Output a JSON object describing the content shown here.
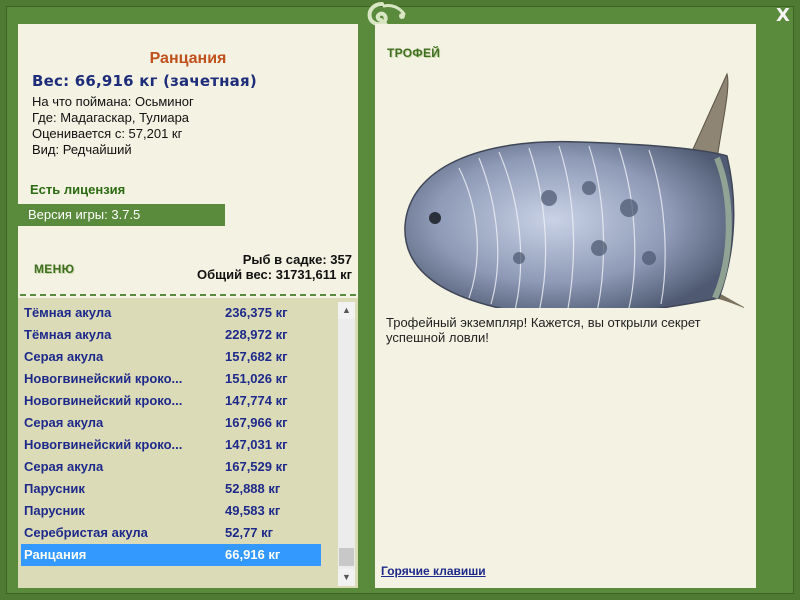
{
  "window": {
    "close_label": "X"
  },
  "left": {
    "fish_name": "Ранцания",
    "weight_line": "Вес: 66,916 кг (зачетная)",
    "info": [
      "На что поймана: Осьминог",
      "Где: Мадагаскар, Тулиара",
      "Оценивается с: 57,201 кг",
      "Вид: Редчайший"
    ],
    "license": "Есть лицензия",
    "version": "Версия игры: 3.7.5",
    "menu_label": "МЕНЮ",
    "fish_in_cage": "Рыб в садке: 357",
    "total_weight": "Общий вес: 31731,611 кг"
  },
  "catch_list": [
    {
      "name": "Тёмная акула",
      "weight": "236,375 кг"
    },
    {
      "name": "Тёмная акула",
      "weight": "228,972 кг"
    },
    {
      "name": "Серая акула",
      "weight": "157,682 кг"
    },
    {
      "name": "Новогвинейский кроко...",
      "weight": "151,026 кг"
    },
    {
      "name": "Новогвинейский кроко...",
      "weight": "147,774 кг"
    },
    {
      "name": "Серая акула",
      "weight": "167,966 кг"
    },
    {
      "name": "Новогвинейский кроко...",
      "weight": "147,031 кг"
    },
    {
      "name": "Серая акула",
      "weight": "167,529 кг"
    },
    {
      "name": "Парусник",
      "weight": "52,888 кг"
    },
    {
      "name": "Парусник",
      "weight": "49,583 кг"
    },
    {
      "name": "Серебристая акула",
      "weight": "52,77 кг"
    },
    {
      "name": "Ранцания",
      "weight": "66,916 кг",
      "selected": true
    }
  ],
  "right": {
    "trophy_label": "ТРОФЕЙ",
    "message": "Трофейный экземпляр! Кажется, вы открыли секрет успешной ловли!",
    "hotkeys": "Горячие клавиши"
  },
  "colors": {
    "frame": "#5a8a3c",
    "panel": "#f4f2e2",
    "list_bg": "#dcdbb8",
    "selection": "#3399ff",
    "fish_name": "#c0501c",
    "link": "#1e2a8a"
  }
}
